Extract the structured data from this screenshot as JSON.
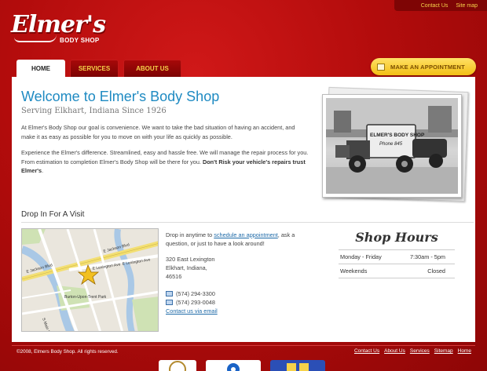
{
  "topbar": {
    "contact": "Contact Us",
    "sitemap": "Site map"
  },
  "logo": {
    "script": "Elmer's",
    "sub": "BODY SHOP"
  },
  "nav": {
    "tabs": [
      {
        "label": "HOME"
      },
      {
        "label": "SERVICES"
      },
      {
        "label": "ABOUT US"
      }
    ]
  },
  "appointment": {
    "label": "MAKE AN APPOINTMENT"
  },
  "main": {
    "title": "Welcome to Elmer's Body Shop",
    "subtitle": "Serving Elkhart, Indiana Since 1926",
    "para1": "At Elmer's Body Shop our goal is convenience. We want to take the bad situation of having an accident, and make it as easy as possible for you to move on with your life as quickly as possible.",
    "para2": "Experience the Elmer's difference. Streamlined, easy and hassle free. We will manage the repair process for you. From estimation to completion Elmer's Body Shop will be there for you.",
    "para2_bold": "Don't Risk your vehicle's repairs trust Elmer's",
    "para2_end": ".",
    "photo_sign": "ELMER'S BODY SHOP",
    "photo_sign2": "Phone 845"
  },
  "visit": {
    "heading": "Drop In For A Visit",
    "intro_prefix": "Drop in anytime to ",
    "intro_link": "schedule an appointment",
    "intro_suffix": ", ask a question, or just to have a look around!",
    "street": "320 East Lexington",
    "city": "Elkhart, Indiana,",
    "zip": "46516",
    "phone1": "(574) 294-3300",
    "phone2": "(574) 293-0048",
    "email_link": "Contact us via email",
    "map_labels": {
      "jackson1": "E Jackson Blvd",
      "jackson2": "E Jackson Blvd",
      "lexington1": "E Lexington Ave",
      "lexington2": "E Lexington Ave",
      "park": "Burton-Upon-Trent Park",
      "main": "S Main St"
    }
  },
  "hours": {
    "title": "Shop Hours",
    "rows": [
      {
        "day": "Monday - Friday",
        "time": "7:30am - 5pm"
      },
      {
        "day": "Weekends",
        "time": "Closed"
      }
    ]
  },
  "footer": {
    "copyright": "©2008, Elmers Body Shop. All rights reserved.",
    "links": [
      {
        "label": "Contact Us"
      },
      {
        "label": "About Us"
      },
      {
        "label": "Services"
      },
      {
        "label": "Sitemap"
      },
      {
        "label": "Home"
      }
    ]
  },
  "colors": {
    "brand_red": "#b30c0c",
    "accent_gold": "#f6d24a",
    "heading_blue": "#1e8ac2"
  }
}
